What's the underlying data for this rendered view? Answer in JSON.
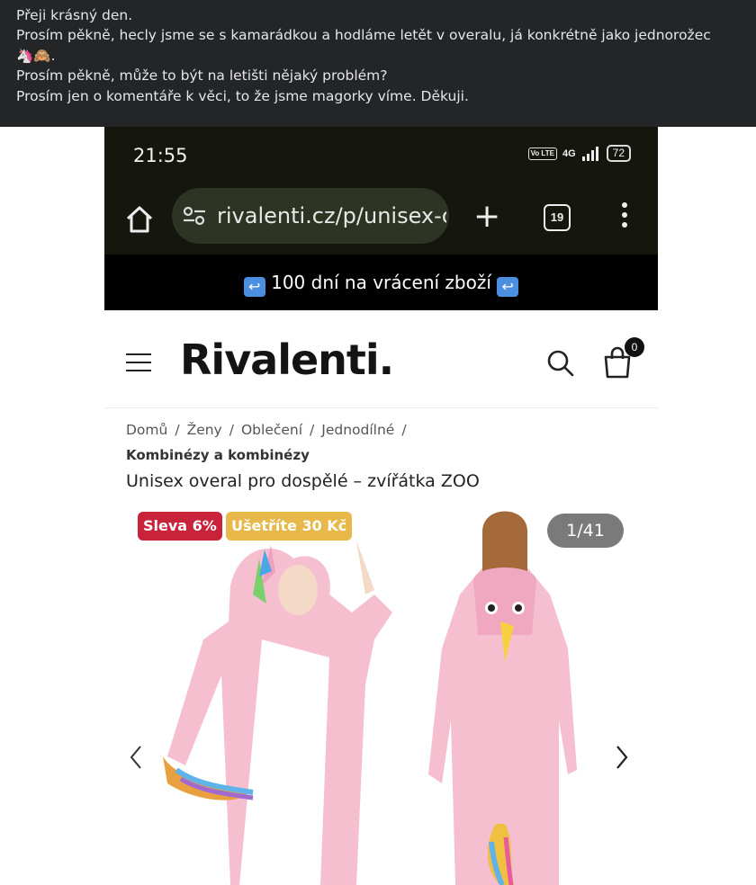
{
  "post": {
    "lines": [
      "Přeji krásný den.",
      "Prosím pěkně, hecly jsme se s kamarádkou a hodláme letět v overalu, já konkrétně jako jednorožec",
      "🦄🙈.",
      "Prosím pěkně, může to být na letišti nějaký problém?",
      "Prosím jen o komentáře k věci, to že jsme magorky víme. Děkuji."
    ]
  },
  "phone": {
    "time": "21:55",
    "lte": "Vo LTE",
    "network": "4G",
    "battery": "72"
  },
  "browser": {
    "url": "rivalenti.cz/p/unisex-c",
    "tab_count": "19",
    "plus": "+"
  },
  "promo": {
    "text": "100 dní na vrácení zboží",
    "icon": "↩"
  },
  "site": {
    "logo": "Rivalenti.",
    "cart_count": "0"
  },
  "breadcrumb": {
    "items": [
      "Domů",
      "Ženy",
      "Oblečení",
      "Jednodílné"
    ],
    "separator": "/",
    "last": "Kombinézy a kombinézy"
  },
  "product": {
    "title": "Unisex overal pro dospělé – zvířátka ZOO",
    "badge_sale": "Sleva 6%",
    "badge_save": "Ušetříte  30 Kč",
    "image_counter": "1/41"
  },
  "colors": {
    "fb_bg": "#242526",
    "browser_bg": "#15170f",
    "sale_red": "#c8233b",
    "save_yellow": "#e8b84a",
    "onesie_pink": "#f5bfd0"
  }
}
